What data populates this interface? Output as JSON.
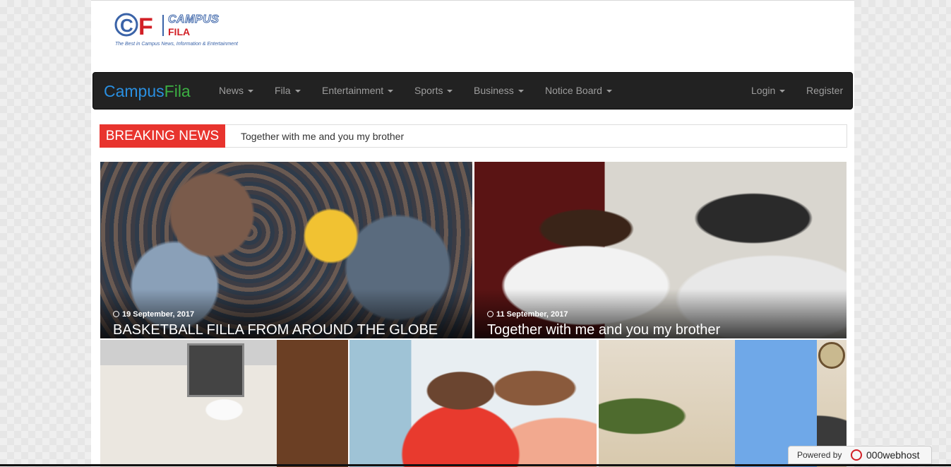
{
  "logo": {
    "mark": "CF",
    "word1": "CAMPUS",
    "word2": "FILA",
    "tagline": "The Best in Campus News, Information & Entertainment"
  },
  "navbar": {
    "brand_part1": "Campus",
    "brand_part2": "Fila",
    "items": [
      {
        "label": "News"
      },
      {
        "label": "Fila"
      },
      {
        "label": "Entertainment"
      },
      {
        "label": "Sports"
      },
      {
        "label": "Business"
      },
      {
        "label": "Notice Board"
      }
    ],
    "login": "Login",
    "register": "Register"
  },
  "breaking": {
    "label": "BREAKING NEWS",
    "text": "Together with me and you my brother"
  },
  "featured": [
    {
      "date": "19 September, 2017",
      "title": "BASKETBALL FILLA FROM AROUND THE GLOBE"
    },
    {
      "date": "11 September, 2017",
      "title": "Together with me and you my brother"
    }
  ],
  "footer_badge": {
    "label": "Powered by",
    "brand": "000webhost"
  },
  "icons": [
    "clock-icon",
    "caret-down-icon",
    "webhost-logo-icon"
  ],
  "colors": {
    "navbar_bg": "#222222",
    "brand_blue": "#2a8fe0",
    "brand_green": "#3cb043",
    "breaking_red": "#e8342e"
  }
}
